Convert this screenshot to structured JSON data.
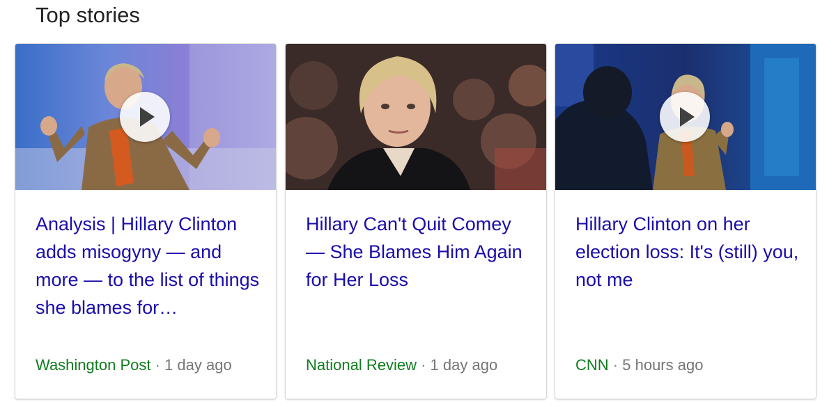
{
  "section": {
    "title": "Top stories"
  },
  "stories": [
    {
      "headline": "Analysis | Hillary Clinton adds misogyny — and more — to the list of things she blames for…",
      "source": "Washington Post",
      "separator": "·",
      "age": "1 day ago",
      "has_video": true,
      "thumbnail": "photo of woman in tan jacket gesturing on stage"
    },
    {
      "headline": "Hillary Can't Quit Comey — She Blames Him Again for Her Loss",
      "source": "National Review",
      "separator": "·",
      "age": "1 day ago",
      "has_video": false,
      "thumbnail": "photo of woman in dark jacket in front of crowd"
    },
    {
      "headline": "Hillary Clinton on her election loss: It's (still) you, not me",
      "source": "CNN",
      "separator": "·",
      "age": "5 hours ago",
      "has_video": true,
      "thumbnail": "photo of woman seated on stage with blue backdrop"
    }
  ],
  "colors": {
    "headline_link": "#1a0dab",
    "source_green": "#0f7d1f",
    "meta_gray": "#757575"
  }
}
